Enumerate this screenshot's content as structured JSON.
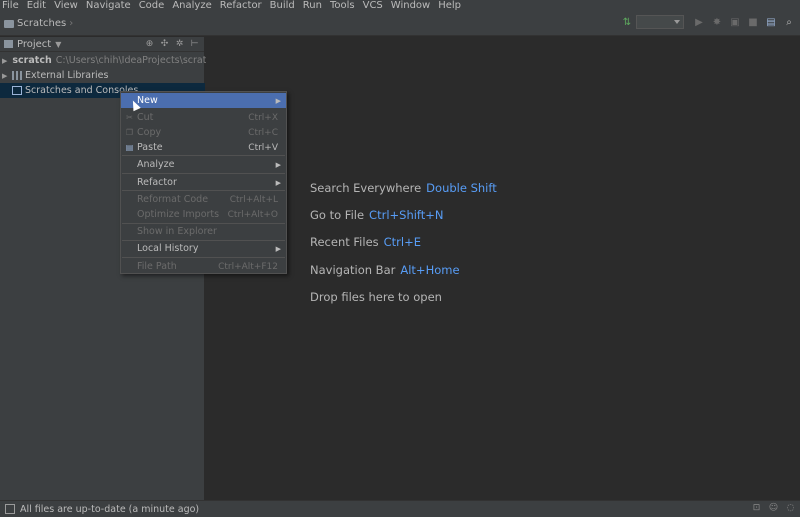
{
  "menubar": {
    "items": [
      "File",
      "Edit",
      "View",
      "Navigate",
      "Code",
      "Analyze",
      "Refactor",
      "Build",
      "Run",
      "Tools",
      "VCS",
      "Window",
      "Help"
    ]
  },
  "breadcrumb": {
    "label": "Scratches"
  },
  "toolbar": {
    "icons": [
      "build-icon",
      "run-config-dropdown",
      "run-icon",
      "debug-icon",
      "coverage-icon",
      "stop-icon",
      "project-structure-icon",
      "search-icon"
    ]
  },
  "project_panel": {
    "title": "Project",
    "tree": [
      {
        "label": "scratch",
        "path": "C:\\Users\\chih\\IdeaProjects\\scratch"
      },
      {
        "label": "External Libraries",
        "path": ""
      },
      {
        "label": "Scratches and Consoles",
        "path": ""
      }
    ]
  },
  "context_menu": {
    "items": [
      {
        "label": "New",
        "shortcut": ""
      },
      {
        "label": "Cut",
        "shortcut": "Ctrl+X"
      },
      {
        "label": "Copy",
        "shortcut": "Ctrl+C"
      },
      {
        "label": "Paste",
        "shortcut": "Ctrl+V"
      },
      {
        "label": "Analyze",
        "shortcut": ""
      },
      {
        "label": "Refactor",
        "shortcut": ""
      },
      {
        "label": "Reformat Code",
        "shortcut": "Ctrl+Alt+L"
      },
      {
        "label": "Optimize Imports",
        "shortcut": "Ctrl+Alt+O"
      },
      {
        "label": "Show in Explorer",
        "shortcut": ""
      },
      {
        "label": "Local History",
        "shortcut": ""
      },
      {
        "label": "File Path",
        "shortcut": "Ctrl+Alt+F12"
      }
    ]
  },
  "editor_hints": [
    {
      "text": "Search Everywhere",
      "key": "Double Shift"
    },
    {
      "text": "Go to File",
      "key": "Ctrl+Shift+N"
    },
    {
      "text": "Recent Files",
      "key": "Ctrl+E"
    },
    {
      "text": "Navigation Bar",
      "key": "Alt+Home"
    },
    {
      "text": "Drop files here to open",
      "key": ""
    }
  ],
  "status": {
    "message": "All files are up-to-date (a minute ago)"
  },
  "colors": {
    "selection": "#4b6eaf",
    "link": "#589df6",
    "background": "#2b2b2b",
    "panel": "#3c3f41"
  }
}
